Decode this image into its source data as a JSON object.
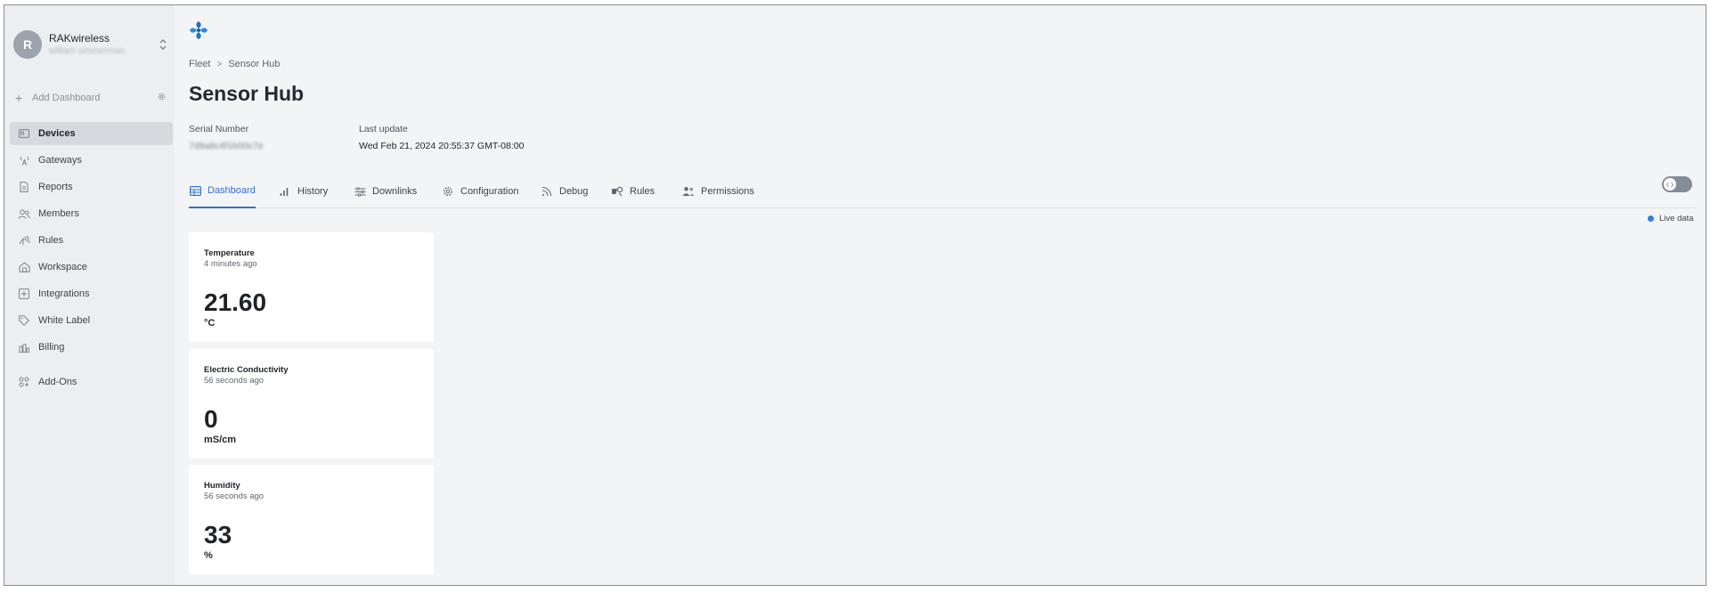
{
  "org": {
    "avatar_letter": "R",
    "name": "RAKwireless",
    "user": "william simmerman"
  },
  "sidebar": {
    "add_dashboard": "Add Dashboard",
    "items": [
      {
        "label": "Devices",
        "icon": "devices-icon",
        "active": true
      },
      {
        "label": "Gateways",
        "icon": "gateway-icon"
      },
      {
        "label": "Reports",
        "icon": "report-icon"
      },
      {
        "label": "Members",
        "icon": "members-icon"
      },
      {
        "label": "Rules",
        "icon": "rules-icon"
      },
      {
        "label": "Workspace",
        "icon": "workspace-icon"
      },
      {
        "label": "Integrations",
        "icon": "integrations-icon"
      },
      {
        "label": "White Label",
        "icon": "tag-icon"
      },
      {
        "label": "Billing",
        "icon": "billing-icon"
      },
      {
        "label": "Add-Ons",
        "icon": "addons-icon"
      }
    ]
  },
  "breadcrumb": {
    "parent": "Fleet",
    "current": "Sensor Hub"
  },
  "device": {
    "title": "Sensor Hub",
    "serial_label": "Serial Number",
    "serial_value": "7d9a8c4f1b00c7e",
    "update_label": "Last update",
    "update_value": "Wed Feb 21, 2024 20:55:37 GMT-08:00"
  },
  "tabs": [
    {
      "label": "Dashboard",
      "icon": "dashboard-icon",
      "active": true
    },
    {
      "label": "History",
      "icon": "history-chart-icon"
    },
    {
      "label": "Downlinks",
      "icon": "downlinks-sliders-icon"
    },
    {
      "label": "Configuration",
      "icon": "gear-icon"
    },
    {
      "label": "Debug",
      "icon": "signal-icon"
    },
    {
      "label": "Rules",
      "icon": "rules-icon"
    },
    {
      "label": "Permissions",
      "icon": "permissions-icon"
    }
  ],
  "live_data": "Live data",
  "cards": [
    {
      "title": "Temperature",
      "time": "4 minutes ago",
      "value": "21.60",
      "unit": "°C"
    },
    {
      "title": "Electric Conductivity",
      "time": "56 seconds ago",
      "value": "0",
      "unit": "mS/cm"
    },
    {
      "title": "Humidity",
      "time": "56 seconds ago",
      "value": "33",
      "unit": "%"
    }
  ],
  "colors": {
    "accent": "#2f6fd8",
    "live_dot": "#2f7fe0",
    "sidebar_bg": "#eceef1",
    "main_bg": "#f3f4f6"
  }
}
